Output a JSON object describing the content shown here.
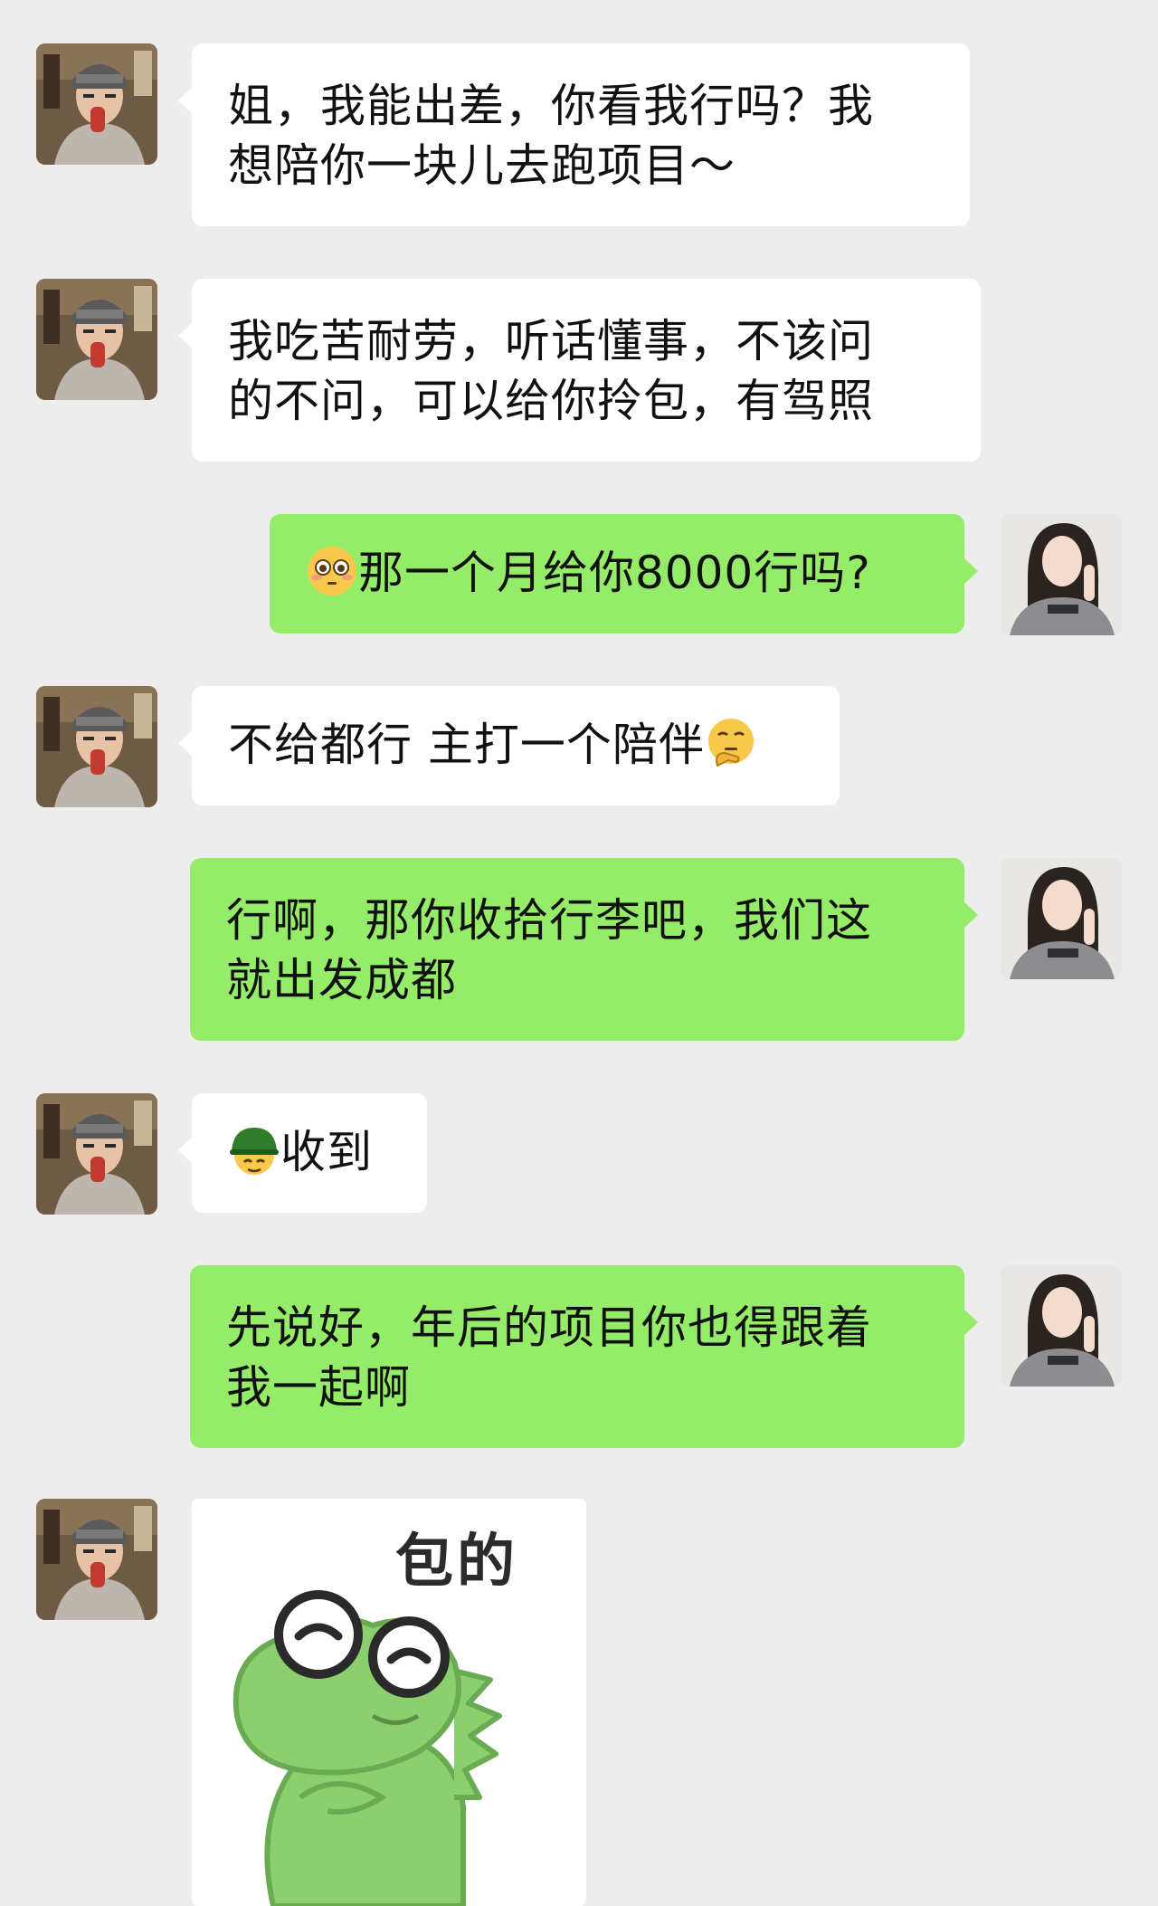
{
  "theme": {
    "background": "#ededed",
    "incoming_bubble": "#ffffff",
    "outgoing_bubble": "#95ec69",
    "text_color": "#111111"
  },
  "messages": [
    {
      "sender": "male",
      "lines": [
        "姐，我能出差，你看我行吗？我",
        "想陪你一块儿去跑项目～"
      ]
    },
    {
      "sender": "male",
      "lines": [
        "我吃苦耐劳，听话懂事，不该问",
        "的不问，可以给你拎包，有驾照"
      ]
    },
    {
      "sender": "female",
      "emoji": "flushed-face-icon",
      "text": "那一个月给你8000行吗?"
    },
    {
      "sender": "male",
      "text": "不给都行 主打一个陪伴",
      "emoji": "thinking-face-icon"
    },
    {
      "sender": "female",
      "lines": [
        "行啊，那你收拾行李吧，我们这",
        "就出发成都"
      ]
    },
    {
      "sender": "male",
      "emoji": "military-helmet-face-icon",
      "text": "收到"
    },
    {
      "sender": "female",
      "lines": [
        "先说好，年后的项目你也得跟着",
        "我一起啊"
      ]
    },
    {
      "sender": "male",
      "sticker": {
        "caption": "包的",
        "icon": "frog-sticker-icon"
      }
    }
  ]
}
